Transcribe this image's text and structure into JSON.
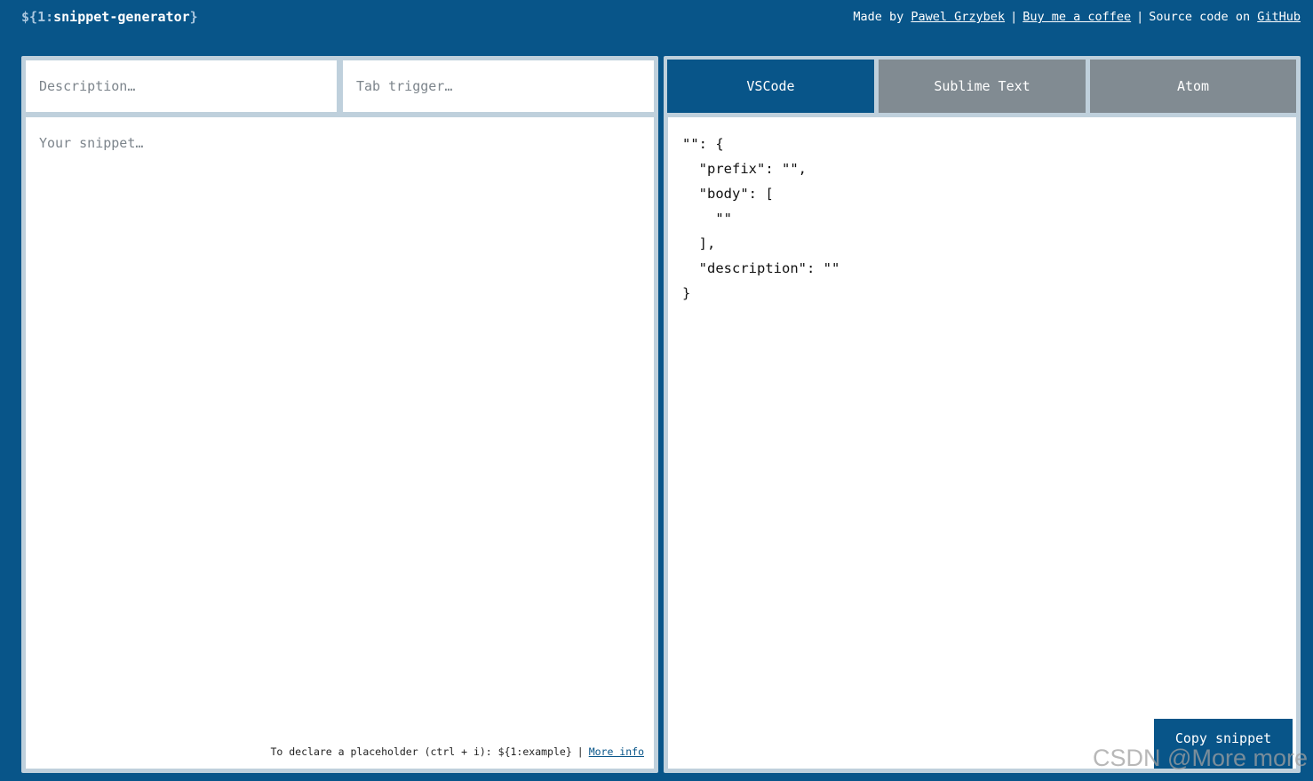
{
  "header": {
    "logo_prefix": "${",
    "logo_number": "1:",
    "logo_name": "snippet-generator",
    "logo_suffix": "}",
    "made_by": "Made by",
    "author": "Pawel Grzybek",
    "coffee": "Buy me a coffee",
    "source_prefix": "Source code on",
    "github": "GitHub",
    "separator": "|"
  },
  "inputs": {
    "description_placeholder": "Description…",
    "trigger_placeholder": "Tab trigger…",
    "snippet_placeholder": "Your snippet…"
  },
  "hint": {
    "text": "To declare a placeholder (ctrl + i): ${1:example}",
    "separator": "|",
    "more_info": "More info"
  },
  "tabs": [
    {
      "label": "VSCode",
      "active": true
    },
    {
      "label": "Sublime Text",
      "active": false
    },
    {
      "label": "Atom",
      "active": false
    }
  ],
  "output": {
    "code": "\"\": {\n  \"prefix\": \"\",\n  \"body\": [\n    \"\"\n  ],\n  \"description\": \"\"\n}"
  },
  "copy_button": "Copy snippet",
  "watermark": "CSDN @More more",
  "colors": {
    "background": "#085589",
    "panel": "#bfd0dc",
    "tab_inactive": "#818b92"
  }
}
